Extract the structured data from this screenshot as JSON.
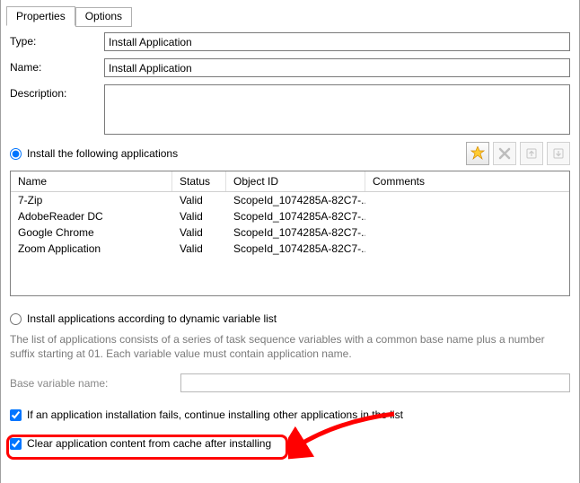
{
  "tabs": {
    "properties": "Properties",
    "options": "Options"
  },
  "form": {
    "type_label": "Type:",
    "type_value": "Install Application",
    "name_label": "Name:",
    "name_value": "Install Application",
    "desc_label": "Description:",
    "desc_value": ""
  },
  "radio1_label": "Install the following applications",
  "toolbar": {
    "new": "New",
    "delete": "Delete",
    "moveup": "Move Up",
    "movedown": "Move Down"
  },
  "table": {
    "headers": {
      "name": "Name",
      "status": "Status",
      "oid": "Object ID",
      "comments": "Comments"
    },
    "rows": [
      {
        "name": "7-Zip",
        "status": "Valid",
        "oid": "ScopeId_1074285A-82C7-...",
        "comments": ""
      },
      {
        "name": "AdobeReader DC",
        "status": "Valid",
        "oid": "ScopeId_1074285A-82C7-...",
        "comments": ""
      },
      {
        "name": "Google Chrome",
        "status": "Valid",
        "oid": "ScopeId_1074285A-82C7-...",
        "comments": ""
      },
      {
        "name": "Zoom Application",
        "status": "Valid",
        "oid": "ScopeId_1074285A-82C7-...",
        "comments": ""
      }
    ]
  },
  "radio2_label": "Install applications according to dynamic variable list",
  "help_text": "The list of applications consists of a series of task sequence variables with a common base name plus a number suffix starting at 01. Each variable value must contain application name.",
  "base_var_label": "Base variable name:",
  "check1_label": "If an application installation fails, continue installing other applications in the list",
  "check2_label": "Clear application content from cache after installing"
}
